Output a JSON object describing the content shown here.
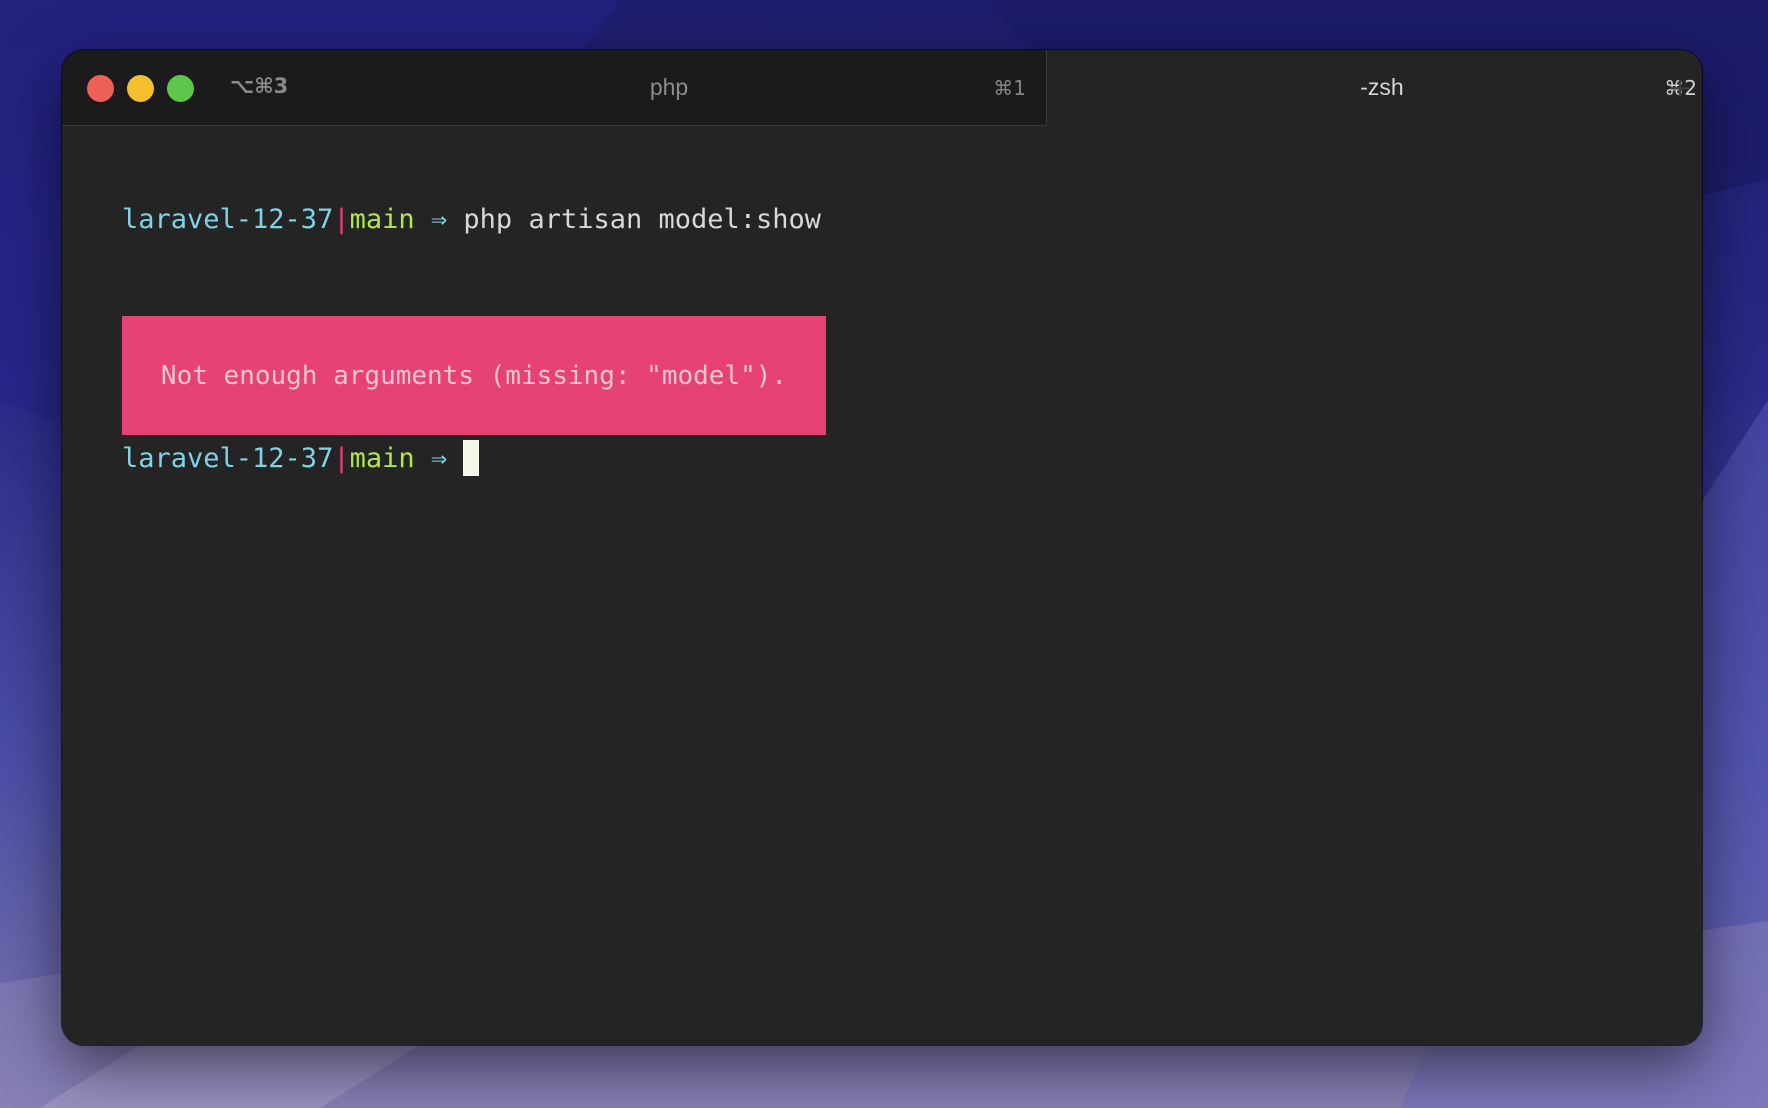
{
  "window": {
    "shortcut_all": "⌥⌘3",
    "new_tab_glyph": "+"
  },
  "tabs": [
    {
      "title": "php",
      "shortcut": "⌘1",
      "active": false
    },
    {
      "title": "-zsh",
      "shortcut": "⌘2",
      "active": true
    }
  ],
  "terminal": {
    "prompt": {
      "dir": "laravel-12-37",
      "separator": "|",
      "branch": "main",
      "arrow": "⇒"
    },
    "command": "php artisan model:show",
    "error": "Not enough arguments (missing: \"model\")."
  },
  "colors": {
    "directory": "#7fd3e6",
    "separator": "#ee3a7a",
    "branch": "#b3e648",
    "error_background": "#e64274"
  }
}
